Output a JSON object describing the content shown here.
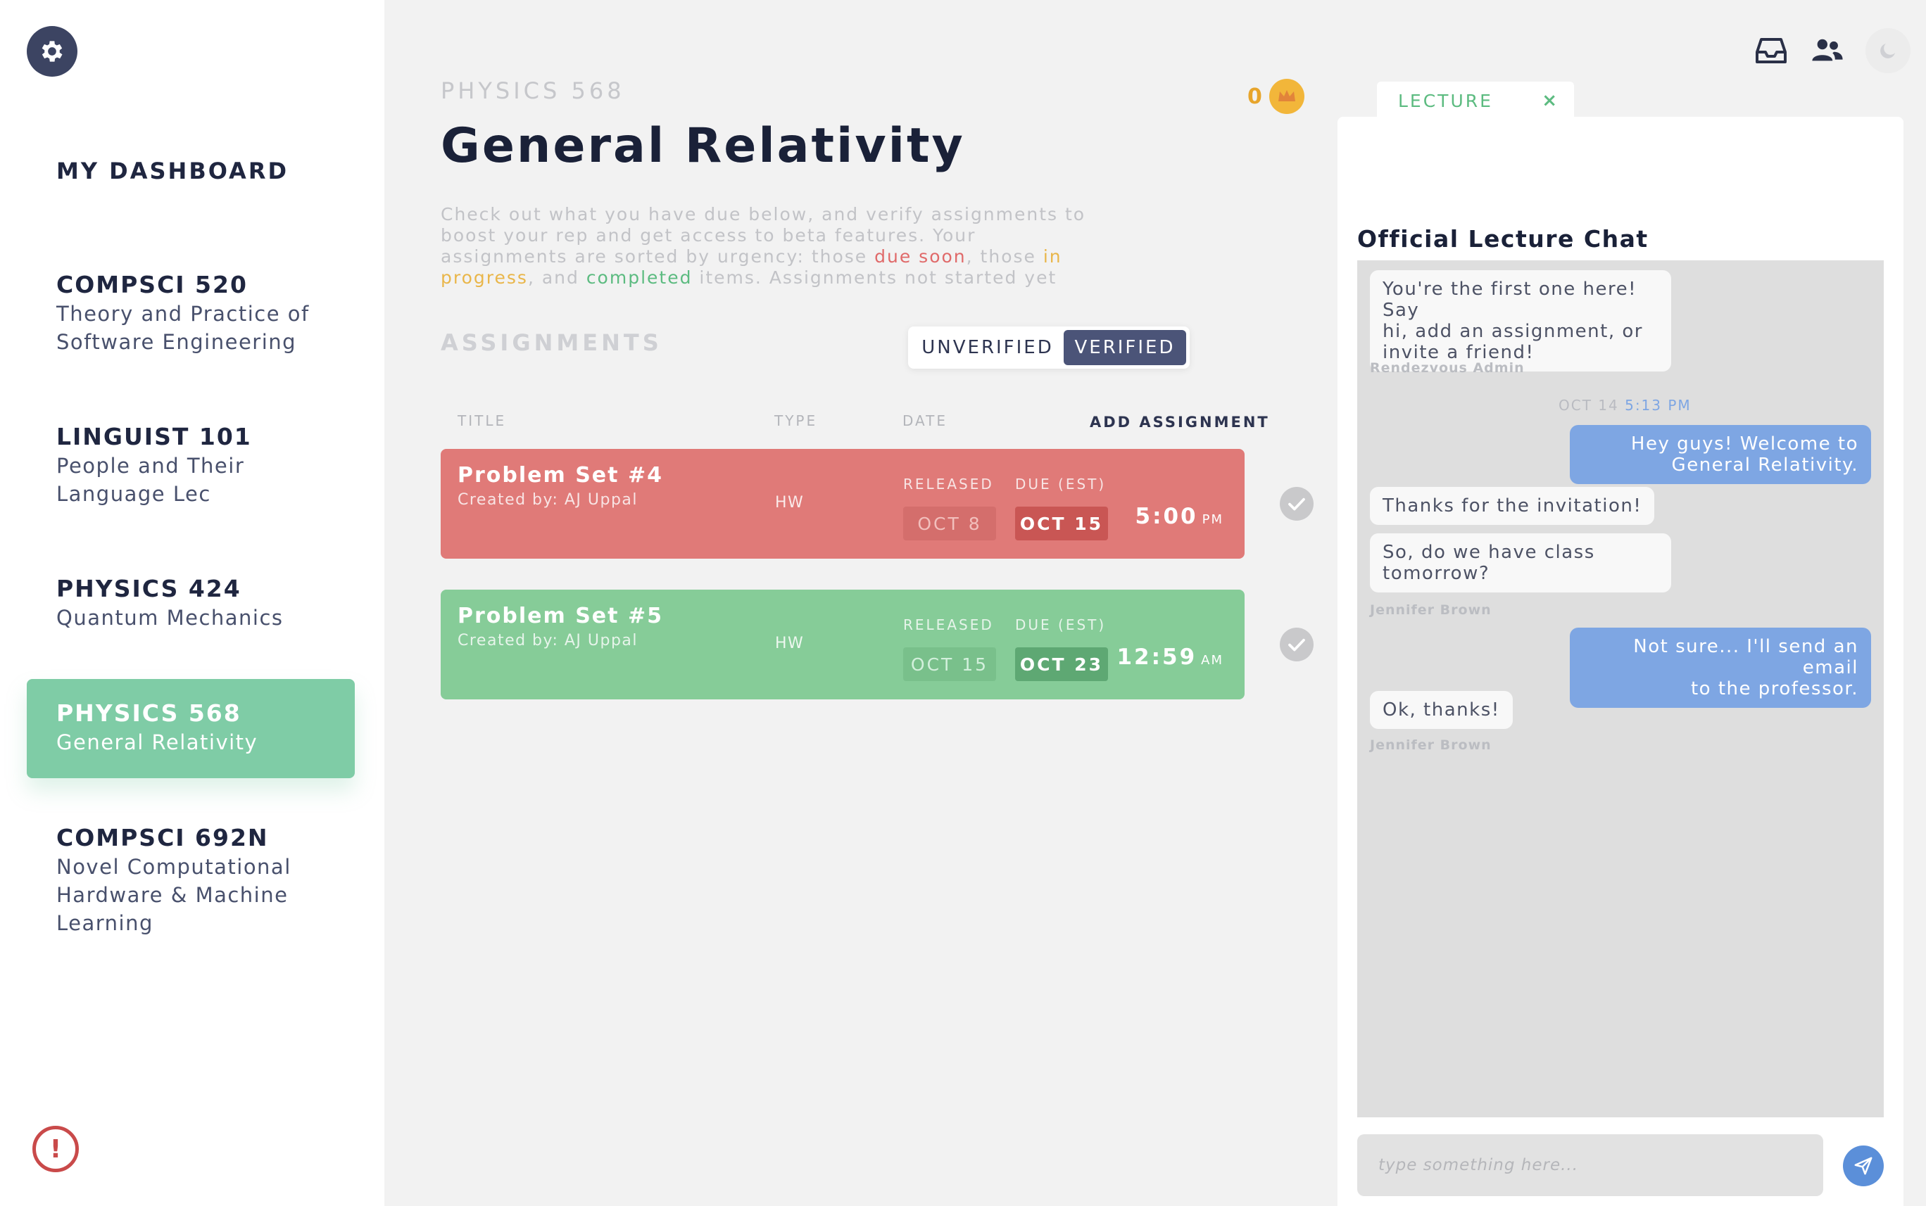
{
  "sidebar": {
    "dashboard_label": "MY DASHBOARD",
    "courses": [
      {
        "code": "COMPSCI 520",
        "name_lines": [
          "Theory and Practice of",
          "Software Engineering"
        ]
      },
      {
        "code": "LINGUIST 101",
        "name_lines": [
          "People and Their",
          "Language Lec"
        ]
      },
      {
        "code": "PHYSICS 424",
        "name_lines": [
          "Quantum Mechanics"
        ]
      },
      {
        "code": "PHYSICS 568",
        "name_lines": [
          "General Relativity"
        ],
        "active": true
      },
      {
        "code": "COMPSCI 692N",
        "name_lines": [
          "Novel Computational",
          "Hardware & Machine",
          "Learning"
        ]
      }
    ],
    "alert_icon_glyph": "!"
  },
  "main": {
    "course_code": "PHYSICS 568",
    "title": "General Relativity",
    "rep_count": "0",
    "intro": {
      "p1": "Check out what you have due below, and verify assignments to boost your rep and get access to beta features. Your assignments are sorted by urgency: those ",
      "due_soon": "due soon",
      "p2": ", those ",
      "in_progress": "in progress",
      "p3": ", and ",
      "completed": "completed",
      "p4": " items. Assignments not started yet"
    },
    "assignments_heading": "ASSIGNMENTS",
    "toggle": {
      "unverified": "UNVERIFIED",
      "verified": "VERIFIED",
      "selected": "VERIFIED"
    },
    "table_headers": {
      "title": "TITLE",
      "type": "TYPE",
      "date": "DATE",
      "add": "ADD ASSIGNMENT"
    },
    "assignments": [
      {
        "title": "Problem Set #4",
        "creator": "Created by: AJ Uppal",
        "type": "HW",
        "released_label": "RELEASED",
        "due_label": "DUE (EST)",
        "released": "OCT 8",
        "due": "OCT 15",
        "time": "5:00",
        "ampm": "PM",
        "status": "due-soon",
        "color": "#e07a78"
      },
      {
        "title": "Problem Set #5",
        "creator": "Created by: AJ Uppal",
        "type": "HW",
        "released_label": "RELEASED",
        "due_label": "DUE (EST)",
        "released": "OCT 15",
        "due": "OCT 23",
        "time": "12:59",
        "ampm": "AM",
        "status": "completed",
        "color": "#86cc98"
      }
    ]
  },
  "chat": {
    "tab_label": "LECTURE",
    "tab_close": "×",
    "title": "Official Lecture Chat",
    "messages": [
      {
        "dir": "in",
        "lines": [
          "You're the first one here! Say",
          "hi, add an assignment, or",
          "invite a friend!"
        ],
        "sender": "Rendezvous Admin"
      },
      {
        "stamp_date": "OCT 14",
        "stamp_time": "5:13 PM"
      },
      {
        "dir": "out",
        "lines": [
          "Hey guys! Welcome to",
          "General Relativity."
        ]
      },
      {
        "dir": "in",
        "lines": [
          "Thanks for the invitation!"
        ]
      },
      {
        "dir": "in",
        "lines": [
          "So, do we have class",
          "tomorrow?"
        ],
        "sender": "Jennifer Brown"
      },
      {
        "dir": "out",
        "lines": [
          "Not sure... I'll send an email",
          "to the professor."
        ]
      },
      {
        "dir": "in",
        "lines": [
          "Ok, thanks!"
        ],
        "sender": "Jennifer Brown"
      }
    ],
    "input_placeholder": "type something here...",
    "colors": {
      "outgoing": "#7ea6e3",
      "incoming": "#f8f8f8",
      "accent": "#5cbb80"
    }
  },
  "top_icons": [
    "inbox-icon",
    "users-icon",
    "moon-icon"
  ]
}
